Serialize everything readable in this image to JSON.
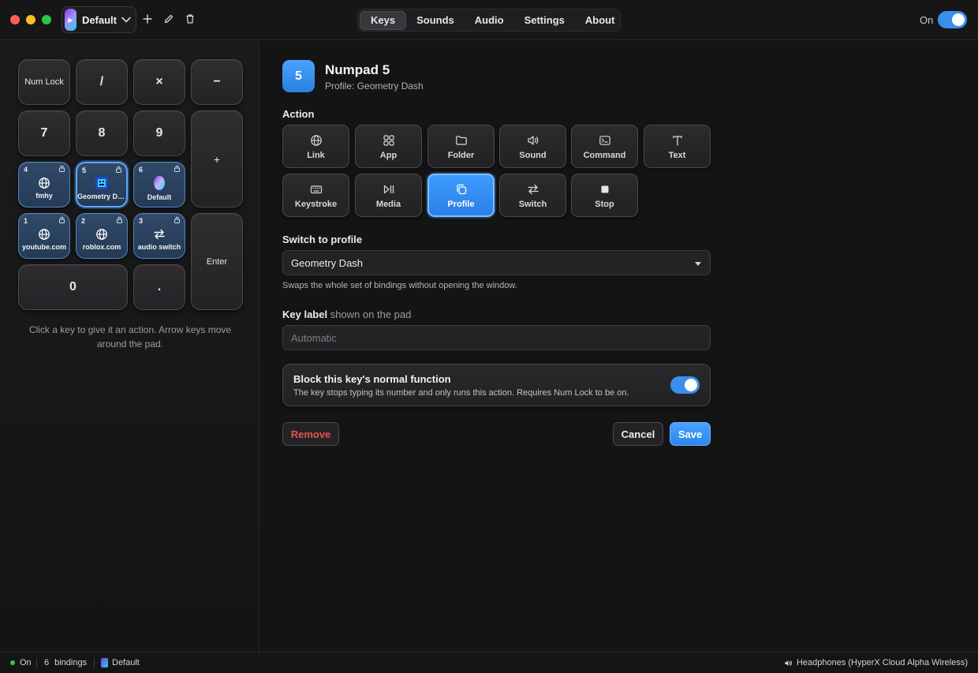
{
  "titlebar": {
    "profile_name": "Default",
    "tabs": [
      {
        "label": "Keys",
        "active": true
      },
      {
        "label": "Sounds",
        "active": false
      },
      {
        "label": "Audio",
        "active": false
      },
      {
        "label": "Settings",
        "active": false
      },
      {
        "label": "About",
        "active": false
      }
    ],
    "power_label": "On",
    "power_on": true
  },
  "keypad": {
    "num_lock": "Num Lock",
    "slash": "/",
    "multiply": "×",
    "minus": "−",
    "plus": "+",
    "enter": "Enter",
    "seven": "7",
    "eight": "8",
    "nine": "9",
    "zero": "0",
    "dot": ".",
    "bound": [
      {
        "number": "4",
        "label": "fmhy",
        "icon": "globe-icon"
      },
      {
        "number": "5",
        "label": "Geometry Dash",
        "icon": "profile-image-icon",
        "selected": true
      },
      {
        "number": "6",
        "label": "Default",
        "icon": "profile-badge-icon"
      },
      {
        "number": "1",
        "label": "youtube.com",
        "icon": "globe-icon"
      },
      {
        "number": "2",
        "label": "roblox.com",
        "icon": "globe-icon"
      },
      {
        "number": "3",
        "label": "audio switch",
        "icon": "switch-arrows-icon"
      }
    ],
    "hint": "Click a key to give it an action. Arrow keys move around the pad."
  },
  "editor": {
    "key_number": "5",
    "key_title": "Numpad 5",
    "key_subtitle": "Profile: Geometry Dash",
    "action_label": "Action",
    "actions": [
      {
        "label": "Link",
        "icon": "globe-icon"
      },
      {
        "label": "App",
        "icon": "grid-icon"
      },
      {
        "label": "Folder",
        "icon": "folder-icon"
      },
      {
        "label": "Sound",
        "icon": "speaker-icon"
      },
      {
        "label": "Command",
        "icon": "terminal-icon"
      },
      {
        "label": "Text",
        "icon": "text-icon"
      },
      {
        "label": "Keystroke",
        "icon": "keyboard-icon"
      },
      {
        "label": "Media",
        "icon": "play-pause-icon"
      },
      {
        "label": "Profile",
        "icon": "copy-icon",
        "active": true
      },
      {
        "label": "Switch",
        "icon": "switch-arrows-icon"
      },
      {
        "label": "Stop",
        "icon": "stop-icon"
      }
    ],
    "switch_label": "Switch to profile",
    "switch_value": "Geometry Dash",
    "switch_help": "Swaps the whole set of bindings without opening the window.",
    "key_label_title": "Key label",
    "key_label_suffix": "shown on the pad",
    "key_label_placeholder": "Automatic",
    "block_title": "Block this key's normal function",
    "block_desc": "The key stops typing its number and only runs this action. Requires Num Lock to be on.",
    "block_enabled": true,
    "remove_label": "Remove",
    "cancel_label": "Cancel",
    "save_label": "Save"
  },
  "statusbar": {
    "status": "On",
    "bindings_count": "6",
    "bindings_label": "bindings",
    "profile": "Default",
    "output_device": "Headphones (HyperX Cloud Alpha Wireless)"
  },
  "colors": {
    "accent": "#3b8eed",
    "danger": "#e5534b",
    "status_ok": "#34c759"
  }
}
